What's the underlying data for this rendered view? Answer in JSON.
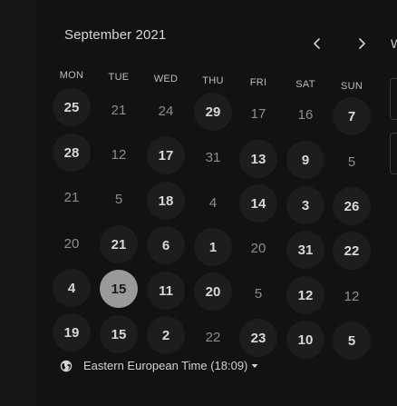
{
  "calendar": {
    "month_title": "September 2021",
    "weekdays": [
      "MON",
      "TUE",
      "WED",
      "THU",
      "FRI",
      "SAT",
      "SUN"
    ],
    "weeks": [
      [
        {
          "label": "25",
          "available": true
        },
        {
          "label": "21",
          "available": false
        },
        {
          "label": "24",
          "available": false
        },
        {
          "label": "29",
          "available": true
        },
        {
          "label": "17",
          "available": false
        },
        {
          "label": "16",
          "available": false
        },
        {
          "label": "7",
          "available": true
        }
      ],
      [
        {
          "label": "28",
          "available": true
        },
        {
          "label": "12",
          "available": false
        },
        {
          "label": "17",
          "available": true
        },
        {
          "label": "31",
          "available": false
        },
        {
          "label": "13",
          "available": true
        },
        {
          "label": "9",
          "available": true
        },
        {
          "label": "5",
          "available": false
        }
      ],
      [
        {
          "label": "21",
          "available": false
        },
        {
          "label": "5",
          "available": false
        },
        {
          "label": "18",
          "available": true
        },
        {
          "label": "4",
          "available": false
        },
        {
          "label": "14",
          "available": true
        },
        {
          "label": "3",
          "available": true
        },
        {
          "label": "26",
          "available": true
        }
      ],
      [
        {
          "label": "20",
          "available": false
        },
        {
          "label": "21",
          "available": true
        },
        {
          "label": "6",
          "available": true
        },
        {
          "label": "1",
          "available": true
        },
        {
          "label": "20",
          "available": false
        },
        {
          "label": "31",
          "available": true
        },
        {
          "label": "22",
          "available": true
        }
      ],
      [
        {
          "label": "4",
          "available": true
        },
        {
          "label": "15",
          "available": true,
          "selected": true
        },
        {
          "label": "11",
          "available": true
        },
        {
          "label": "20",
          "available": true
        },
        {
          "label": "5",
          "available": false
        },
        {
          "label": "12",
          "available": true
        },
        {
          "label": "12",
          "available": false
        }
      ],
      [
        {
          "label": "19",
          "available": true
        },
        {
          "label": "15",
          "available": true
        },
        {
          "label": "2",
          "available": true
        },
        {
          "label": "22",
          "available": false
        },
        {
          "label": "23",
          "available": true
        },
        {
          "label": "10",
          "available": true
        },
        {
          "label": "5",
          "available": true
        }
      ]
    ]
  },
  "timezone": {
    "label": "Eastern European Time (18:09)",
    "icon": "globe-icon"
  },
  "right_panel": {
    "partial_letter": "W"
  },
  "colors": {
    "background": "#121212",
    "available_circle": "#1d1d1d",
    "selected_circle": "#9a9a9a",
    "text": "#d8d8d8",
    "muted_text": "#8d8d8d"
  }
}
